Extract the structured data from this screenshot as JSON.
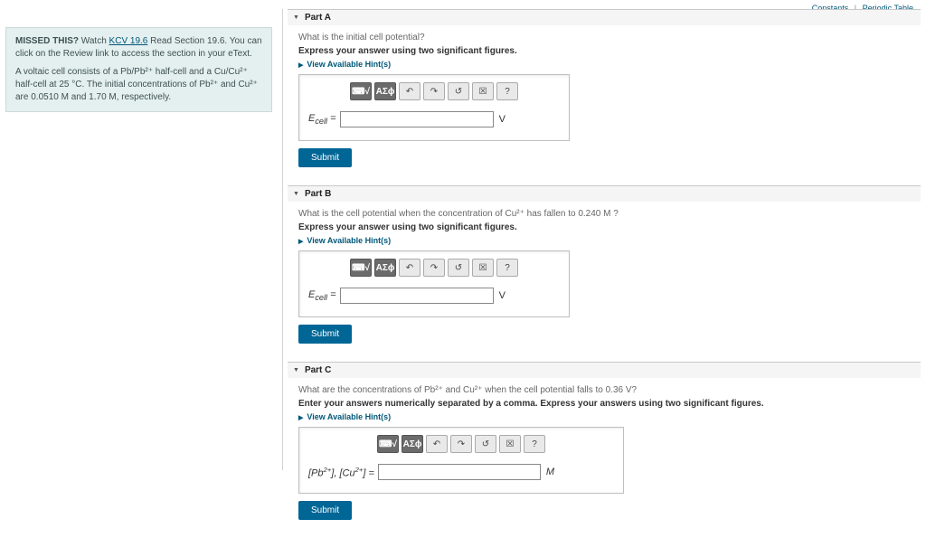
{
  "top": {
    "constants": "Constants",
    "periodic": "Periodic Table"
  },
  "left": {
    "missed": "MISSED THIS?",
    "watch": " Watch ",
    "kcv": "KCV 19.6",
    "read1": " Read Section 19.6. You can click on the Review link to access the section in your eText.",
    "body": "A voltaic cell consists of a Pb/Pb²⁺ half-cell and a Cu/Cu²⁺ half-cell at 25 °C. The initial concentrations of Pb²⁺ and Cu²⁺ are 0.0510 M and 1.70 M, respectively."
  },
  "hints": "View Available Hint(s)",
  "submit": "Submit",
  "tb": {
    "keys": "⌨√",
    "sym": "ΑΣϕ",
    "undo": "↶",
    "redo": "↷",
    "reset": "↺",
    "flag": "☒",
    "help": "?"
  },
  "partA": {
    "title": "Part A",
    "question": "What is the initial cell potential?",
    "instruction": "Express your answer using two significant figures.",
    "label": "Ecell =",
    "unit": "V"
  },
  "partB": {
    "title": "Part B",
    "question": "What is the cell potential when the concentration of Cu²⁺ has fallen to 0.240 M ?",
    "instruction": "Express your answer using two significant figures.",
    "label": "Ecell =",
    "unit": "V"
  },
  "partC": {
    "title": "Part C",
    "question": "What are the concentrations of Pb²⁺ and Cu²⁺ when the cell potential falls to 0.36 V?",
    "instruction": "Enter your answers numerically separated by a comma. Express your answers using two significant figures.",
    "label": "[Pb²⁺], [Cu²⁺] =",
    "unit": "M"
  }
}
